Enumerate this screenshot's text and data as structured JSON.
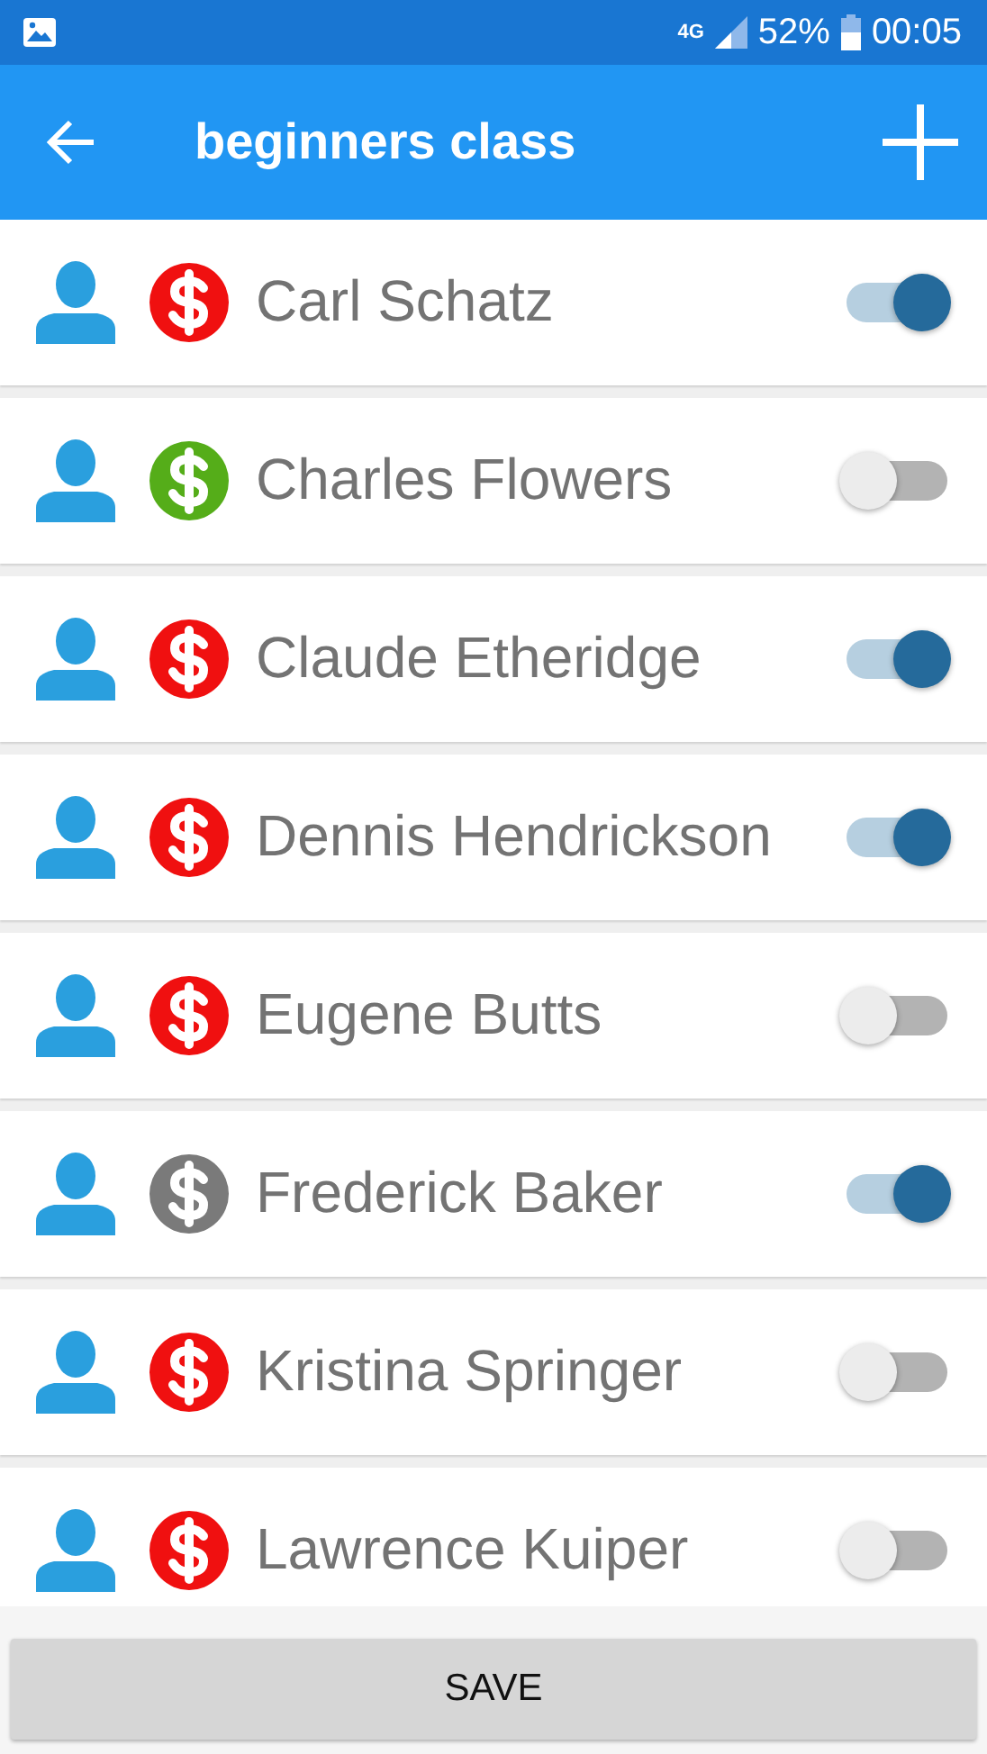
{
  "status_bar": {
    "network": "4G",
    "battery": "52%",
    "time": "00:05"
  },
  "app_bar": {
    "title": "beginners class"
  },
  "students": [
    {
      "name": "Carl Schatz",
      "color": "#f01010",
      "on": true
    },
    {
      "name": "Charles Flowers",
      "color": "#55ad19",
      "on": false
    },
    {
      "name": "Claude Etheridge",
      "color": "#f01010",
      "on": true
    },
    {
      "name": "Dennis Hendrickson",
      "color": "#f01010",
      "on": true
    },
    {
      "name": "Eugene Butts",
      "color": "#f01010",
      "on": false
    },
    {
      "name": "Frederick Baker",
      "color": "#7a7a7a",
      "on": true
    },
    {
      "name": "Kristina Springer",
      "color": "#f01010",
      "on": false
    },
    {
      "name": "Lawrence Kuiper",
      "color": "#f01010",
      "on": false
    }
  ],
  "save_button": "SAVE"
}
